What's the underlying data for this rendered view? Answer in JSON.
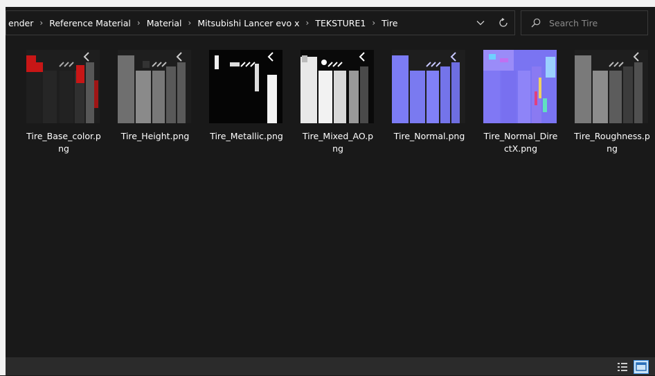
{
  "breadcrumbs": [
    {
      "label": "ender"
    },
    {
      "label": "Reference Material"
    },
    {
      "label": "Material"
    },
    {
      "label": "Mitsubishi Lancer evo x"
    },
    {
      "label": "TEKSTURE1"
    },
    {
      "label": "Tire"
    }
  ],
  "breadcrumb_separator": ">",
  "search": {
    "placeholder": "Search Tire"
  },
  "icons": {
    "dropdown": "chevron-down-icon",
    "refresh": "refresh-icon",
    "search": "search-icon",
    "details_view": "details-view-icon",
    "large_icons_view": "large-icons-view-icon"
  },
  "files": [
    {
      "name": "Tire_Base_color.png",
      "line1": "Tire_Base_color.p",
      "line2": "ng"
    },
    {
      "name": "Tire_Height.png",
      "line1": "Tire_Height.png",
      "line2": ""
    },
    {
      "name": "Tire_Metallic.png",
      "line1": "Tire_Metallic.png",
      "line2": ""
    },
    {
      "name": "Tire_Mixed_AO.png",
      "line1": "Tire_Mixed_AO.p",
      "line2": "ng"
    },
    {
      "name": "Tire_Normal.png",
      "line1": "Tire_Normal.png",
      "line2": ""
    },
    {
      "name": "Tire_Normal_DirectX.png",
      "line1": "Tire_Normal_Dire",
      "line2": "ctX.png"
    },
    {
      "name": "Tire_Roughness.png",
      "line1": "Tire_Roughness.p",
      "line2": "ng"
    }
  ],
  "colors": {
    "background": "#191919",
    "status_bar": "#2b2b2b",
    "text": "#ffffff",
    "border": "#3a3a3a",
    "accent": "#3d8ee0"
  }
}
